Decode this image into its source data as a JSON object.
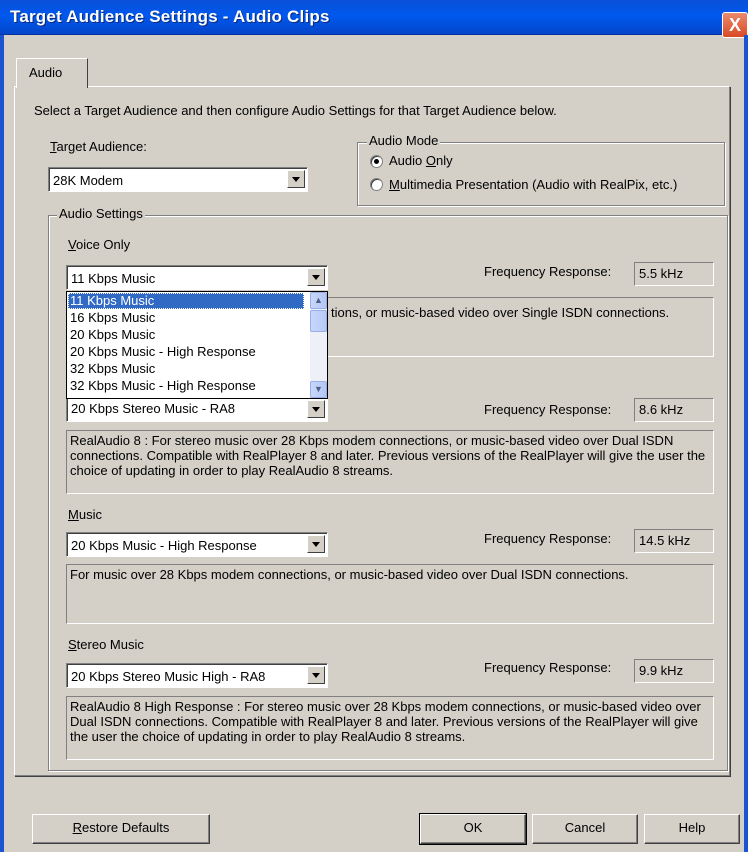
{
  "window": {
    "title": "Target Audience Settings - Audio Clips",
    "close_glyph": "X"
  },
  "tabs": [
    {
      "label": "Audio"
    }
  ],
  "intro": "Select a Target Audience and then configure Audio Settings for that Target Audience below.",
  "target_audience": {
    "label_first": "T",
    "label_rest": "arget Audience:",
    "value": "28K Modem"
  },
  "audio_mode": {
    "legend": "Audio Mode",
    "options": [
      {
        "pre": "Audio ",
        "key": "O",
        "post": "nly",
        "selected": true
      },
      {
        "pre": "",
        "key": "M",
        "post": "ultimedia Presentation (Audio with RealPix, etc.)",
        "selected": false
      }
    ]
  },
  "audio_settings": {
    "legend": "Audio Settings",
    "freq_label": "Frequency Response:",
    "voice": {
      "label_first": "V",
      "label_rest": "oice Only",
      "value": "11 Kbps Music",
      "freq": "5.5 kHz",
      "desc": "tions, or music-based video over Single ISDN connections."
    },
    "stereo_voice": {
      "value": "20 Kbps Stereo Music - RA8",
      "freq": "8.6 kHz",
      "desc": "RealAudio 8 : For stereo music over 28 Kbps modem connections, or music-based video over Dual ISDN connections. Compatible with RealPlayer 8 and later.  Previous versions of the RealPlayer will give the user the choice of updating in order to play RealAudio 8 streams."
    },
    "music": {
      "label_first": "M",
      "label_rest": "usic",
      "value": "20 Kbps Music - High Response",
      "freq": "14.5 kHz",
      "desc": "For music over 28 Kbps modem connections, or music-based video over Dual ISDN connections."
    },
    "stereo_music": {
      "label_first": "S",
      "label_rest": "tereo Music",
      "value": "20 Kbps Stereo Music High - RA8",
      "freq": "9.9 kHz",
      "desc": "RealAudio 8 High Response : For stereo music over 28 Kbps modem connections, or music-based video over Dual ISDN connections. Compatible with RealPlayer 8 and later.  Previous versions of the RealPlayer will give the user the choice of updating in order to play RealAudio 8 streams."
    }
  },
  "dropdown_list": [
    "11 Kbps Music",
    "16 Kbps Music",
    "20 Kbps Music",
    "20 Kbps Music - High Response",
    "32 Kbps Music",
    "32 Kbps Music - High Response"
  ],
  "buttons": {
    "restore_first": "R",
    "restore_rest": "estore Defaults",
    "ok": "OK",
    "cancel": "Cancel",
    "help": "Help"
  }
}
